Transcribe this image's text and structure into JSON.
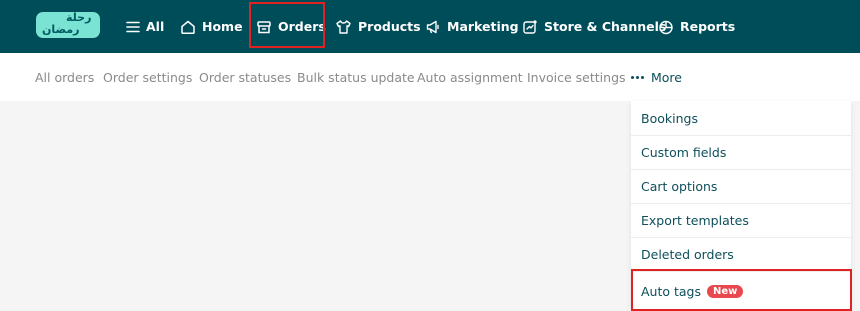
{
  "logo": {
    "line1": "رحلة",
    "line2": "رمضان"
  },
  "nav": {
    "all": "All",
    "home": "Home",
    "orders": "Orders",
    "products": "Products",
    "marketing": "Marketing",
    "store_channels": "Store & Channels",
    "reports": "Reports"
  },
  "subnav": {
    "items": [
      "All orders",
      "Order settings",
      "Order statuses",
      "Bulk status update",
      "Auto assignment",
      "Invoice settings"
    ],
    "more": "More"
  },
  "dropdown": {
    "items": [
      "Bookings",
      "Custom fields",
      "Cart options",
      "Export templates",
      "Deleted orders",
      "Auto tags"
    ],
    "badge": "New"
  },
  "colors": {
    "topbar": "#004d5a",
    "accent": "#0d4f5a",
    "highlight": "#e02222",
    "badge": "#e8484e"
  }
}
